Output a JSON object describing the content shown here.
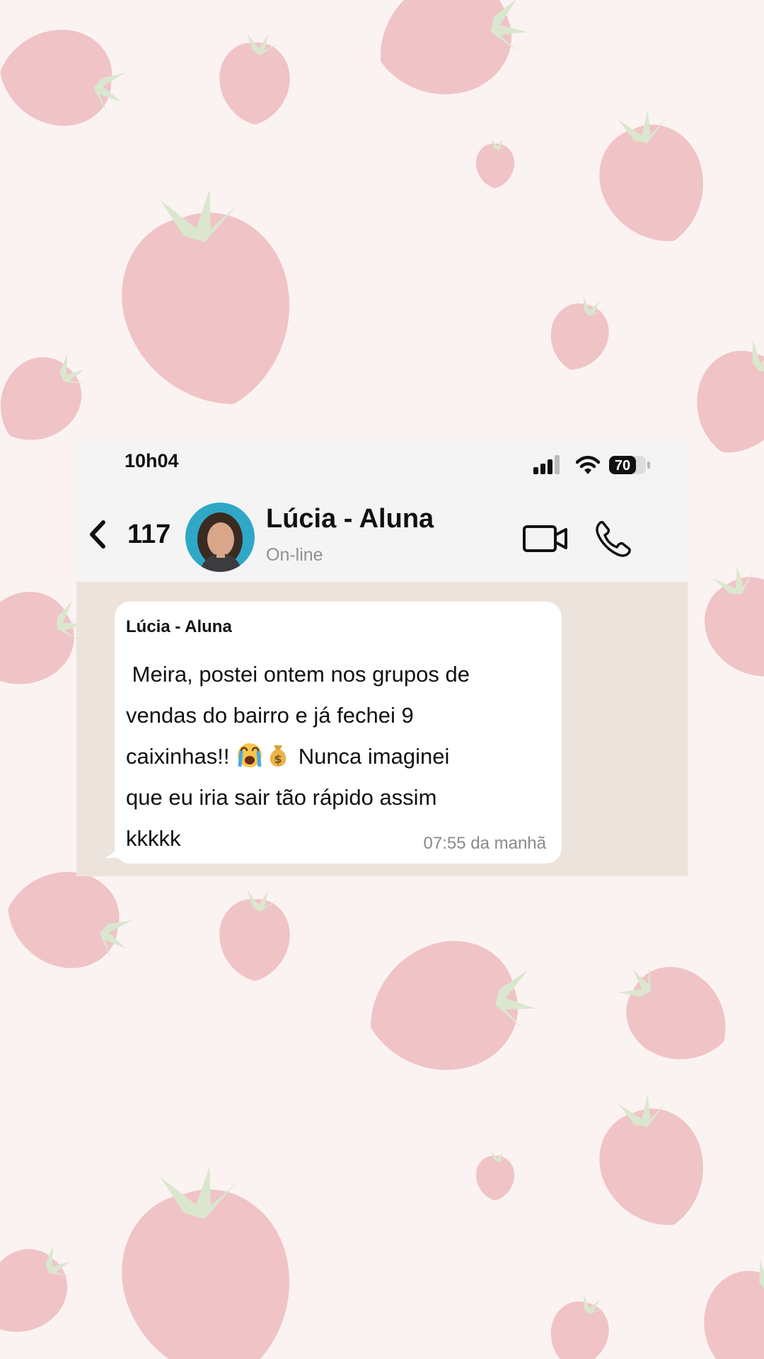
{
  "status_bar": {
    "time": "10h04",
    "battery": "70"
  },
  "chat_header": {
    "back_count": "117",
    "contact_name": "Lúcia - Aluna",
    "contact_status": "On-line"
  },
  "message": {
    "sender": "Lúcia - Aluna",
    "lines": [
      " Meira, postei ontem nos grupos de",
      "vendas do bairro e já fechei 9",
      "caixinhas!! ",
      " Nunca imaginei",
      "que eu iria sair tão rápido assim",
      "kkkkk"
    ],
    "emojis": [
      "crying-face-emoji",
      "money-bag-emoji"
    ],
    "time": "07:55 da manhã"
  },
  "background": {
    "pattern": "strawberry-pattern",
    "color": "#fbf3f2",
    "strawberry_color": "#e9aab0"
  },
  "icons": [
    "back-chevron-icon",
    "video-camera-icon",
    "phone-icon",
    "signal-icon",
    "wifi-icon",
    "battery-icon"
  ]
}
